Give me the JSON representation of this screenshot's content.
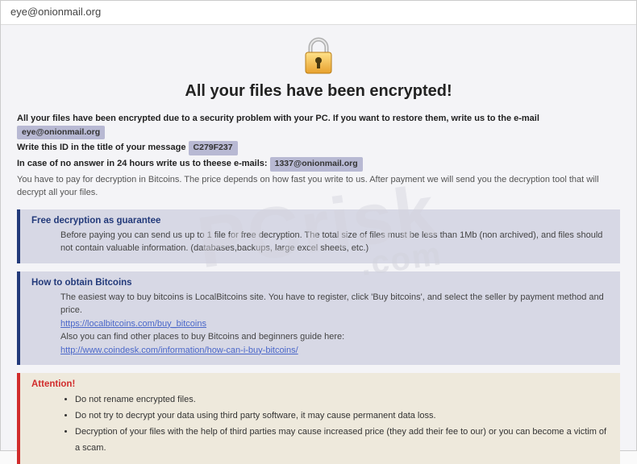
{
  "window": {
    "title": "eye@onionmail.org"
  },
  "headline": "All your files have been encrypted!",
  "intro": {
    "line1_a": "All your files have been encrypted due to a security problem with your PC. If you want to restore them, write us to the e-mail",
    "email1": "eye@onionmail.org",
    "line2_a": "Write this ID in the title of your message",
    "id": "C279F237",
    "line3_a": "In case of no answer in 24 hours write us to theese e-mails:",
    "email2": "1337@onionmail.org",
    "note": "You have to pay for decryption in Bitcoins. The price depends on how fast you write to us. After payment we will send you the decryption tool that will decrypt all your files."
  },
  "sections": {
    "guarantee": {
      "title": "Free decryption as guarantee",
      "body": "Before paying you can send us up to 1 file for free decryption. The total size of files must be less than 1Mb (non archived), and files should not contain valuable information. (databases,backups, large excel sheets, etc.)"
    },
    "bitcoins": {
      "title": "How to obtain Bitcoins",
      "body1": "The easiest way to buy bitcoins is LocalBitcoins site. You have to register, click 'Buy bitcoins', and select the seller by payment method and price.",
      "link1": "https://localbitcoins.com/buy_bitcoins",
      "body2": "Also you can find other places to buy Bitcoins and beginners guide here:",
      "link2": "http://www.coindesk.com/information/how-can-i-buy-bitcoins/"
    },
    "attention": {
      "title": "Attention!",
      "items": [
        "Do not rename encrypted files.",
        "Do not try to decrypt your data using third party software, it may cause permanent data loss.",
        "Decryption of your files with the help of third parties may cause increased price (they add their fee to our) or you can become a victim of a scam."
      ]
    }
  },
  "watermark": {
    "main": "PCrisk",
    "sub": ".com"
  }
}
